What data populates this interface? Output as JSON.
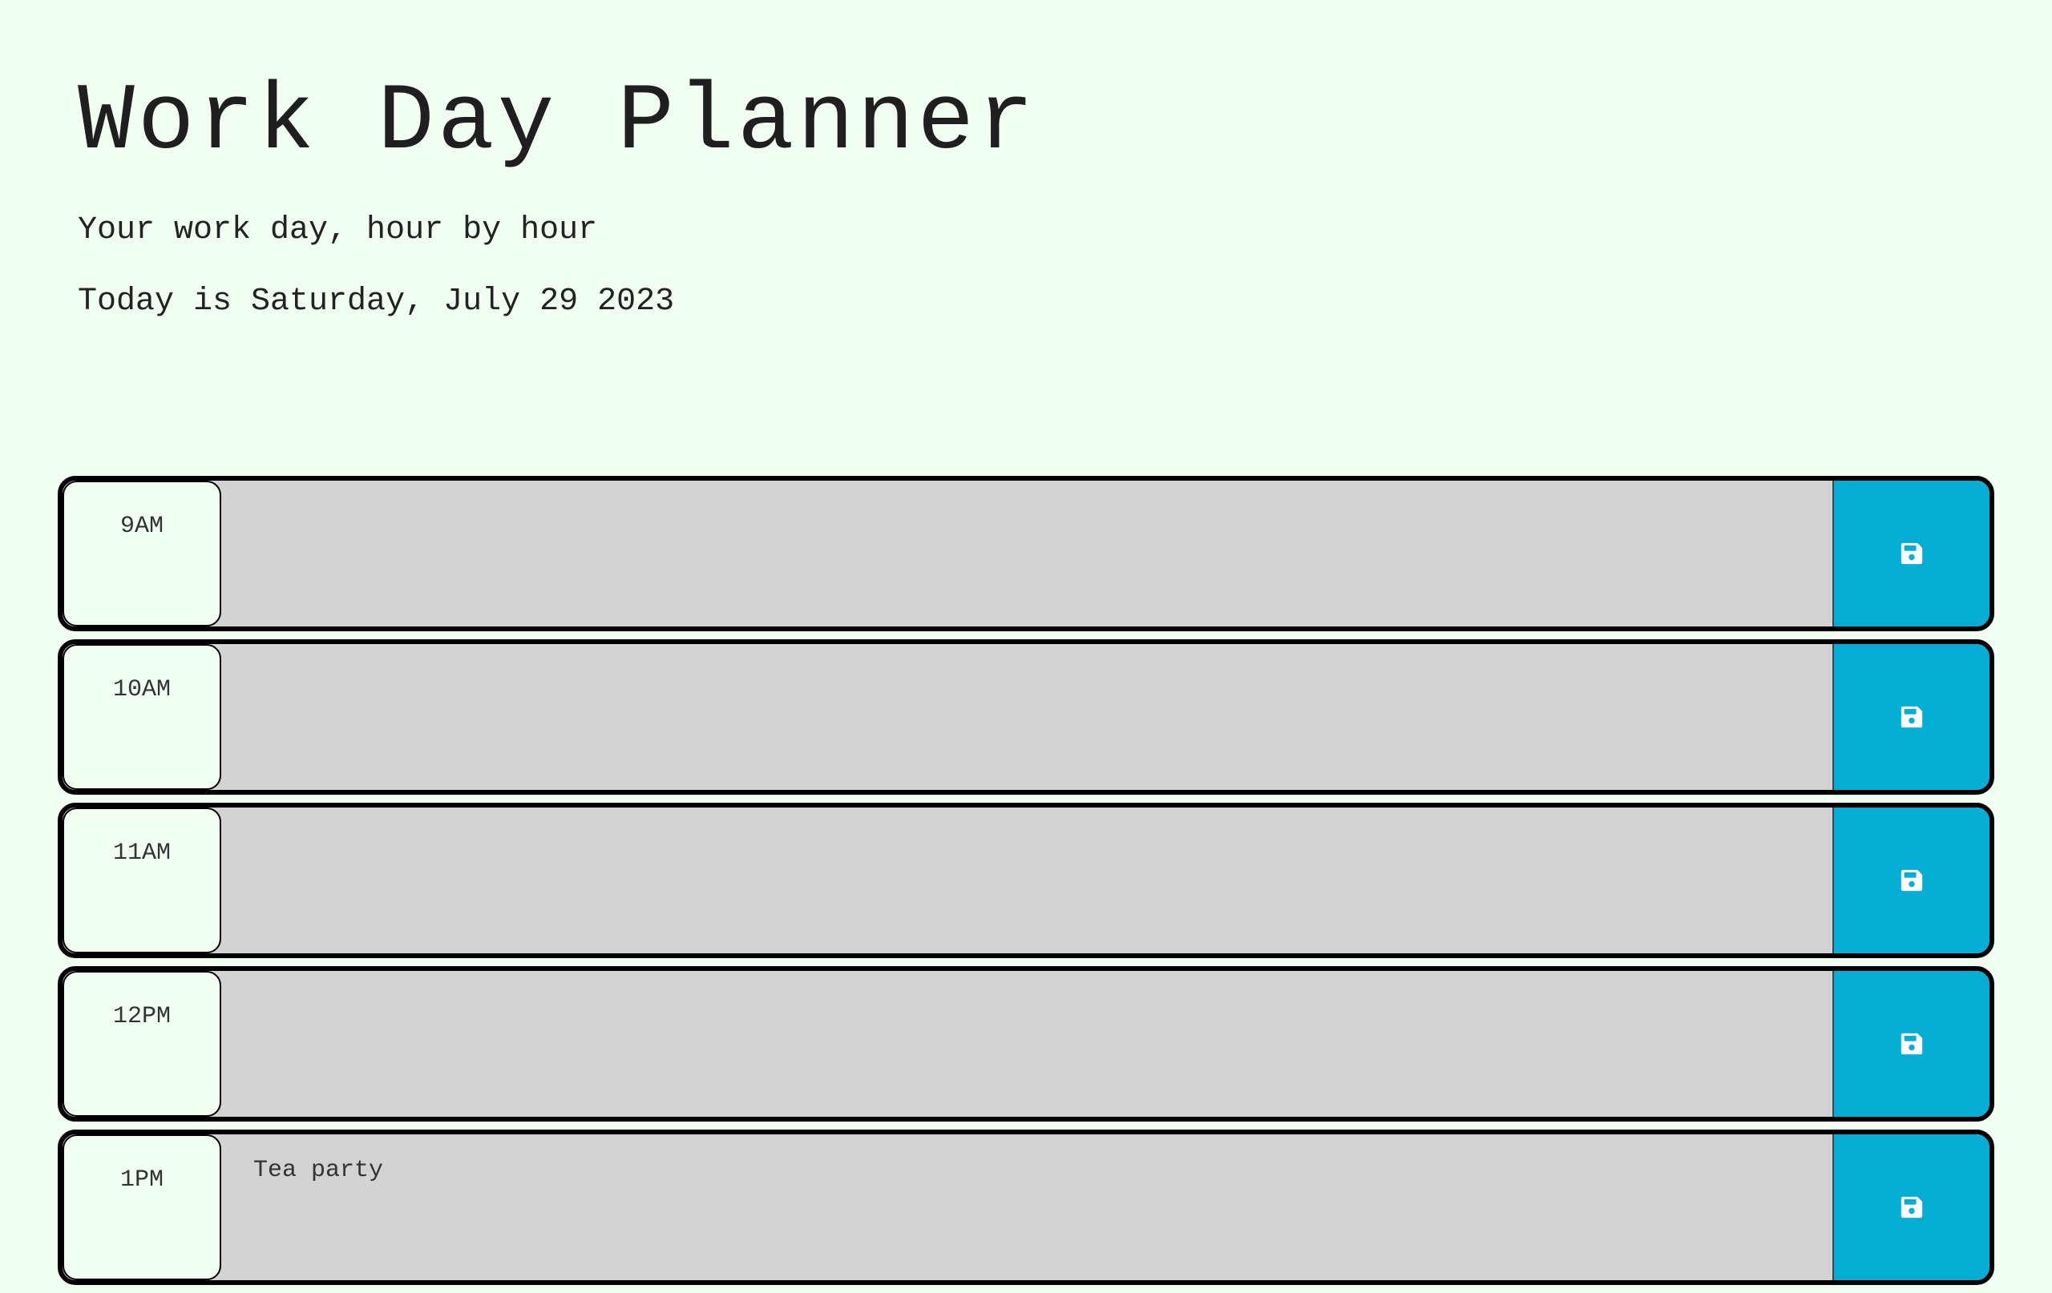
{
  "header": {
    "title": "Work Day Planner",
    "subtitle": "Your work day, hour by hour",
    "date": "Today is Saturday, July 29 2023"
  },
  "colors": {
    "background": "#f0fff0",
    "past_row": "#d3d3d3",
    "save_button": "#06aed5"
  },
  "save_icon": "floppy-disk-icon",
  "rows": [
    {
      "hour": "9AM",
      "note": ""
    },
    {
      "hour": "10AM",
      "note": ""
    },
    {
      "hour": "11AM",
      "note": ""
    },
    {
      "hour": "12PM",
      "note": ""
    },
    {
      "hour": "1PM",
      "note": "Tea party"
    }
  ]
}
